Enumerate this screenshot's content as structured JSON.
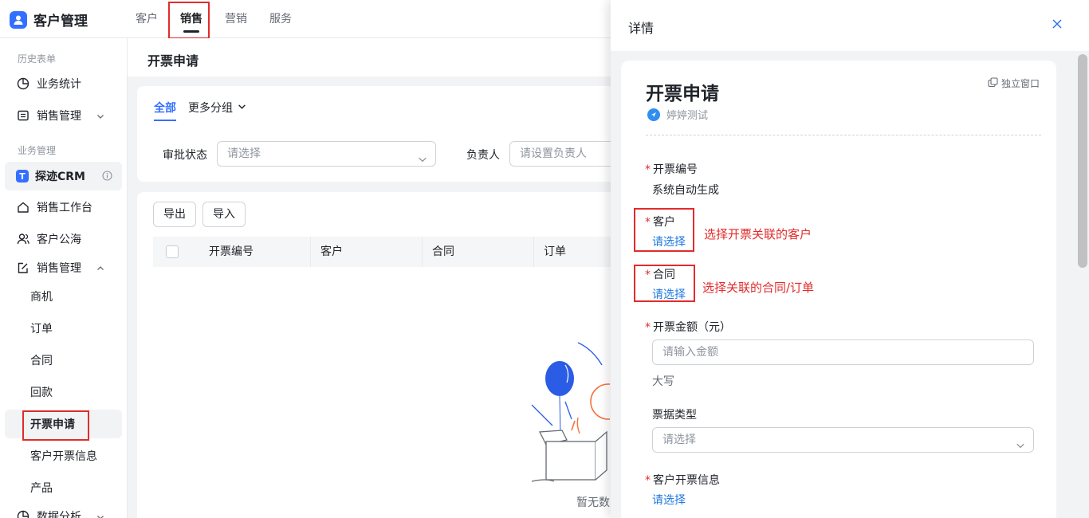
{
  "app": {
    "title": "客户管理",
    "brand_color": "#3370ff"
  },
  "topnav": {
    "items": [
      "客户",
      "销售",
      "营销",
      "服务"
    ],
    "active_index": 1
  },
  "sidebar": {
    "history_label": "历史表单",
    "business_label": "业务管理",
    "items": {
      "business_stats": "业务统计",
      "sales_mgmt_history": "销售管理",
      "crm": "探迹CRM",
      "sales_workbench": "销售工作台",
      "customer_pool": "客户公海",
      "sales_mgmt": "销售管理",
      "opportunity": "商机",
      "order": "订单",
      "contract": "合同",
      "payment": "回款",
      "invoice_request": "开票申请",
      "customer_invoice_info": "客户开票信息",
      "product": "产品",
      "data_analysis": "数据分析"
    }
  },
  "main": {
    "page_title": "开票申请",
    "tabs": {
      "all": "全部",
      "more": "更多分组"
    },
    "filters": {
      "approval_status_label": "审批状态",
      "approval_status_placeholder": "请选择",
      "owner_label": "负责人",
      "owner_placeholder": "请设置负责人"
    },
    "buttons": {
      "export": "导出",
      "import": "导入"
    },
    "columns": [
      "开票编号",
      "客户",
      "合同",
      "订单"
    ],
    "empty_text": "暂无数"
  },
  "drawer": {
    "title": "详情",
    "form_title": "开票申请",
    "popout": "独立窗口",
    "owner": "婷婷测试",
    "fields": {
      "invoice_no_label": "开票编号",
      "invoice_no_value": "系统自动生成",
      "customer_label": "客户",
      "customer_value": "请选择",
      "contract_label": "合同",
      "contract_value": "请选择",
      "amount_label": "开票金额（元）",
      "amount_placeholder": "请输入金额",
      "amount_caps": "大写",
      "ticket_type_label": "票据类型",
      "ticket_type_placeholder": "请选择",
      "customer_invoice_label": "客户开票信息",
      "customer_invoice_value": "请选择"
    },
    "annotations": {
      "customer": "选择开票关联的客户",
      "contract": "选择关联的合同/订单"
    }
  }
}
